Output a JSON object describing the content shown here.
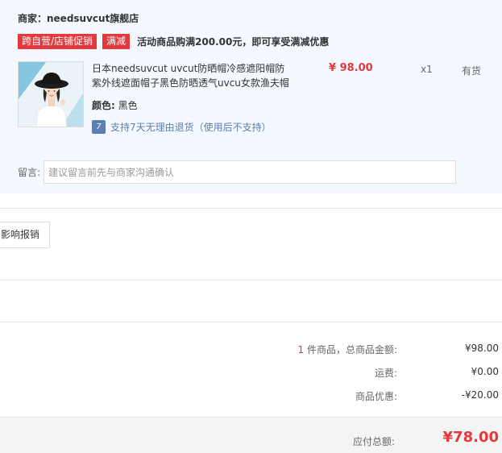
{
  "store": {
    "name": "商家：needsuvcut旗舰店",
    "promo_tags": [
      "跨自营/店铺促销",
      "满减"
    ],
    "promo_text": "活动商品购满200.00元，即可享受满减优惠"
  },
  "product": {
    "title": "日本needsuvcut uvcut防晒帽冷感遮阳帽防紫外线遮面帽子黑色防晒透气uvcu女款渔夫帽",
    "price": "¥ 98.00",
    "quantity": "x1",
    "stock": "有货",
    "color_label": "颜色:",
    "color_value": "黑色",
    "return_icon": "7",
    "return_text": "支持7天无理由退货（使用后不支持）"
  },
  "note": {
    "label": "留言:",
    "placeholder": "建议留言前先与商家沟通确认"
  },
  "report": {
    "label": "影响报销"
  },
  "summary": {
    "count": "1",
    "goods_label": " 件商品，总商品金额:",
    "goods_value": "¥98.00",
    "shipping_label": "运费:",
    "shipping_value": "¥0.00",
    "discount_label": "商品优惠:",
    "discount_value": "-¥20.00",
    "total_label": "应付总额:",
    "total_value": "¥78.00"
  },
  "colors": {
    "accent_red": "#e4393c",
    "panel_bg": "#f3f9fe",
    "link_blue": "#5f7eac"
  }
}
